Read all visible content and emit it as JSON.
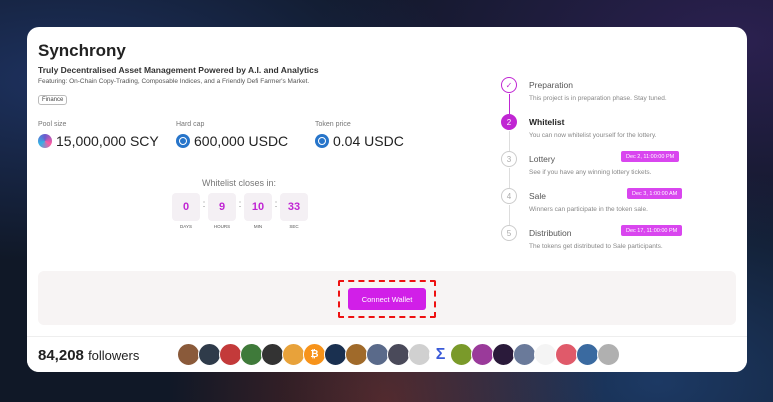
{
  "project": {
    "name": "Synchrony",
    "tagline": "Truly Decentralised Asset Management Powered by A.I. and Analytics",
    "featuring": "Featuring: On-Chain Copy-Trading, Composable Indices, and a Friendly Defi Farmer's Market.",
    "tag": "Finance"
  },
  "stats": {
    "pool_size": {
      "label": "Pool size",
      "value": "15,000,000 SCY",
      "icon": "scy-token-icon"
    },
    "hard_cap": {
      "label": "Hard cap",
      "value": "600,000 USDC",
      "icon": "usdc-token-icon"
    },
    "token_price": {
      "label": "Token price",
      "value": "0.04 USDC",
      "icon": "usdc-token-icon"
    }
  },
  "countdown": {
    "title": "Whitelist closes in:",
    "days": {
      "value": "0",
      "unit": "DAYS"
    },
    "hours": {
      "value": "9",
      "unit": "HOURS"
    },
    "min": {
      "value": "10",
      "unit": "MIN"
    },
    "sec": {
      "value": "33",
      "unit": "SEC"
    },
    "separator": ":"
  },
  "steps": [
    {
      "number": "✓",
      "name": "Preparation",
      "desc": "This project is in preparation phase. Stay tuned.",
      "badge": ""
    },
    {
      "number": "2",
      "name": "Whitelist",
      "desc": "You can now whitelist yourself for the lottery.",
      "badge": ""
    },
    {
      "number": "3",
      "name": "Lottery",
      "desc": "See if you have any winning lottery tickets.",
      "badge": "Dec 2, 11:00:00 PM"
    },
    {
      "number": "4",
      "name": "Sale",
      "desc": "Winners can participate in the token sale.",
      "badge": "Dec 3, 1:00:00 AM"
    },
    {
      "number": "5",
      "name": "Distribution",
      "desc": "The tokens get distributed to Sale participants.",
      "badge": "Dec 17, 11:00:00 PM"
    }
  ],
  "wallet": {
    "button_label": "Connect Wallet"
  },
  "footer": {
    "followers_count": "84,208",
    "followers_label": "followers"
  },
  "colors": {
    "accent": "#c026d3",
    "button": "#d11fe8",
    "highlight_outline": "#ee1111"
  }
}
